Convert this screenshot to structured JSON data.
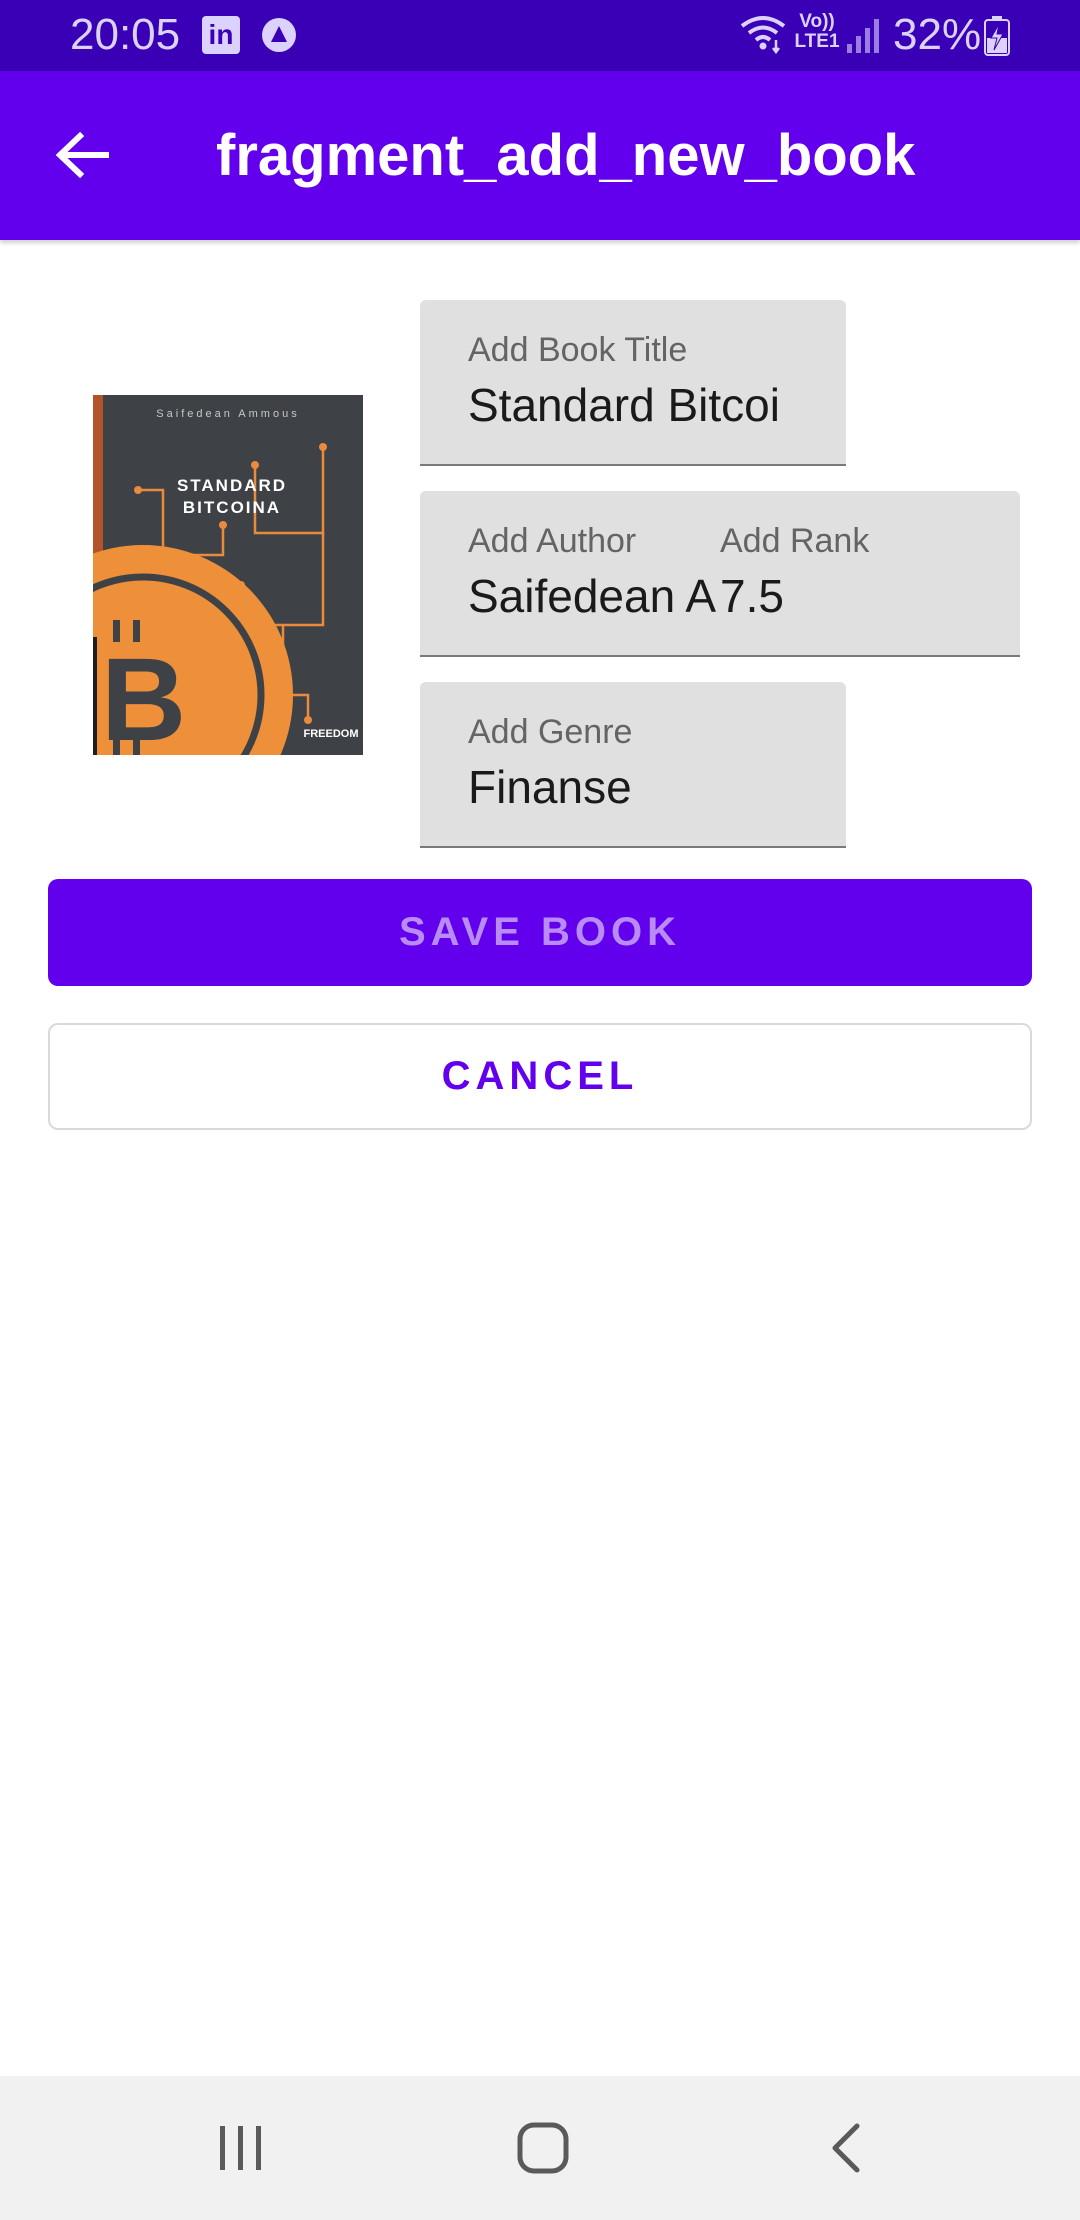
{
  "status_bar": {
    "time": "20:05",
    "linkedin_glyph": "in",
    "volte_line1": "Vo))",
    "volte_line2": "LTE1",
    "battery": "32%",
    "icons": [
      "linkedin-icon",
      "app-notification-icon",
      "wifi-icon",
      "volte-icon",
      "signal-icon",
      "battery-charging-icon"
    ]
  },
  "app_bar": {
    "title": "fragment_add_new_book",
    "back_icon": "arrow-back-icon"
  },
  "cover": {
    "author": "Saifedean Ammous",
    "title_line1": "STANDARD",
    "title_line2": "BITCOINA",
    "bitcoin_symbol": "B",
    "publisher": "FREEDOM"
  },
  "form": {
    "title_label": "Add Book Title",
    "title_value": "Standard Bitcoi",
    "author_label": "Add Author",
    "author_value": "Saifedean A",
    "rank_label": "Add Rank",
    "rank_value": "7.5",
    "genre_label": "Add Genre",
    "genre_value": "Finanse"
  },
  "buttons": {
    "save": "SAVE BOOK",
    "cancel": "CANCEL"
  },
  "colors": {
    "status_bar": "#3a00b5",
    "primary": "#6200ee",
    "field_bg": "#e0e0e0"
  },
  "nav_bar": {
    "icons": [
      "recent-apps-icon",
      "home-icon",
      "back-icon"
    ]
  }
}
